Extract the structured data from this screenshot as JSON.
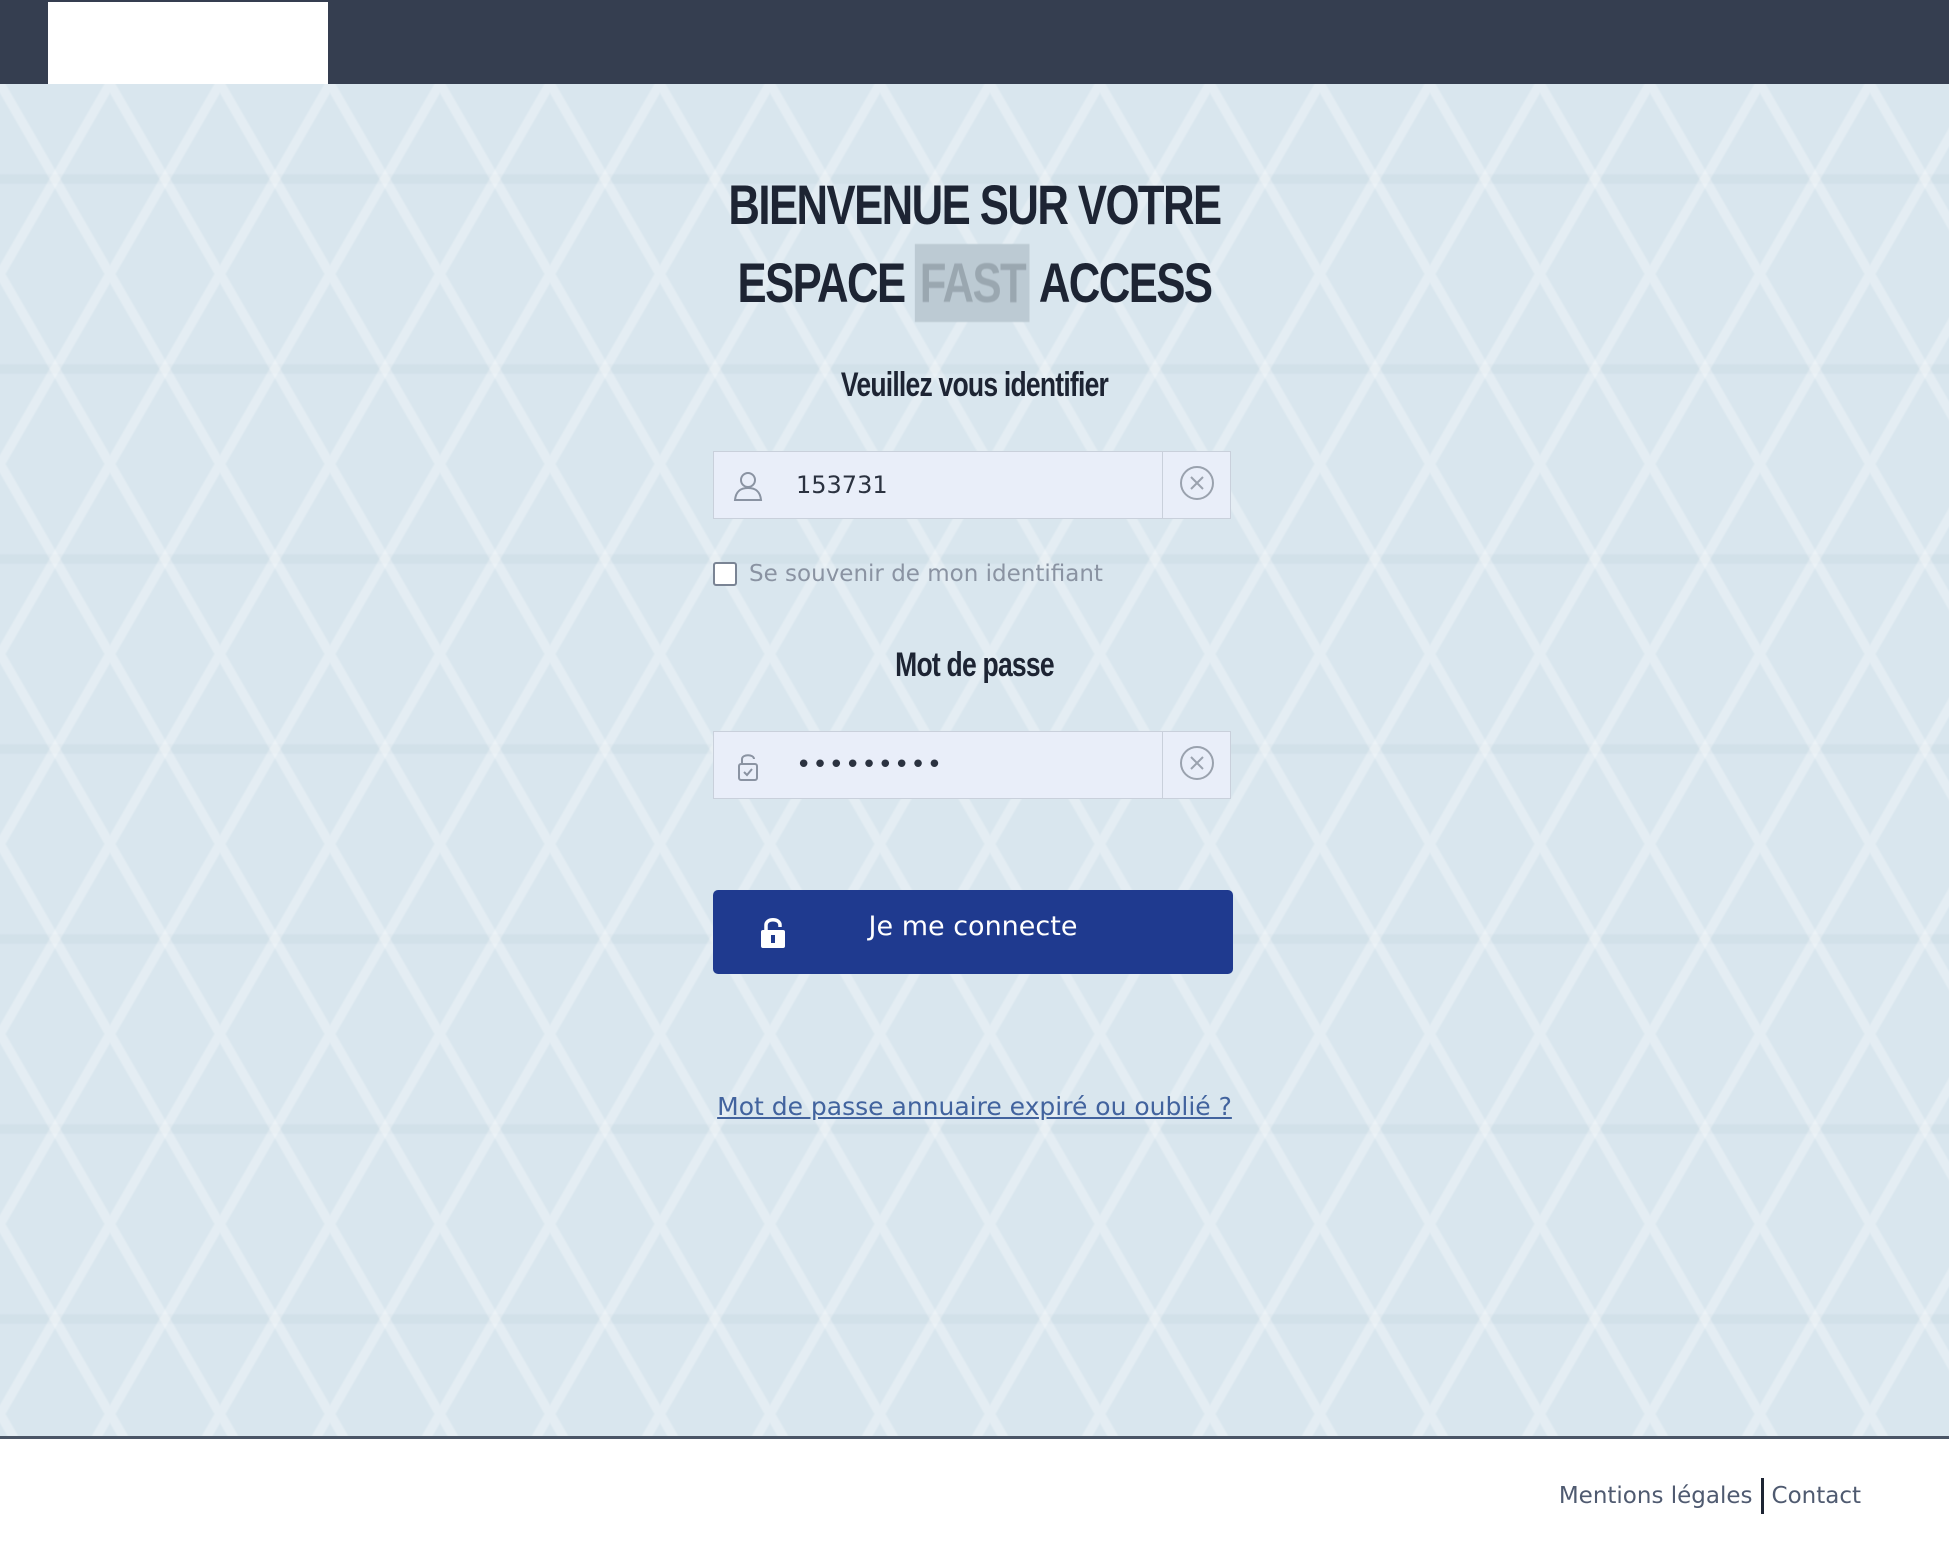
{
  "header": {
    "logo_alt": ""
  },
  "main": {
    "title_line1": "BIENVENUE SUR VOTRE",
    "title_line2_prefix": "ESPACE",
    "title_line2_masked": "FAST",
    "title_line2_suffix": "ACCESS",
    "identify_label": "Veuillez vous identifier",
    "username": {
      "value": "153731",
      "icon": "user-icon",
      "clear_icon": "clear-icon"
    },
    "remember": {
      "label": "Se souvenir de mon identifiant",
      "checked": false
    },
    "password_label": "Mot de passe",
    "password": {
      "value": "•••••••••",
      "icon": "lock-icon",
      "clear_icon": "clear-icon"
    },
    "connect_button": {
      "label": "Je me connecte",
      "icon": "unlock-icon"
    },
    "forgot_link": "Mot de passe annuaire expiré ou oublié ?"
  },
  "footer": {
    "legal_link": "Mentions légales",
    "contact_link": "Contact"
  },
  "colors": {
    "topbar": "#353e50",
    "background": "#d9e6ee",
    "button": "#1f3a8f",
    "link": "#42639e"
  }
}
